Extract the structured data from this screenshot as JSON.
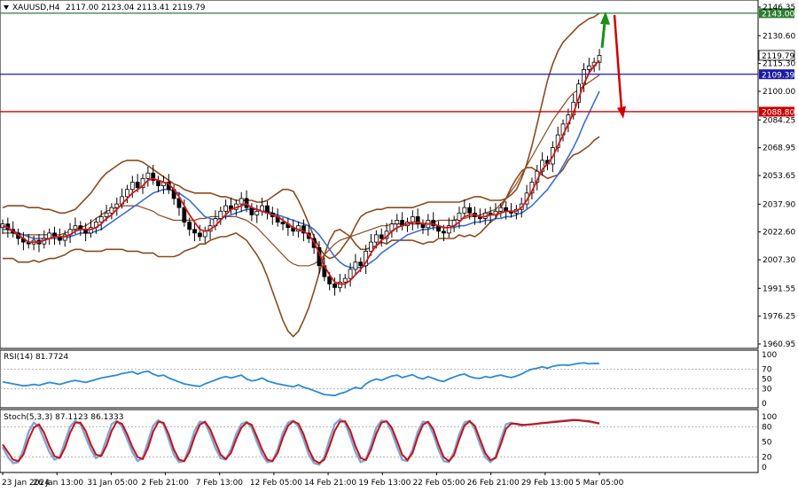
{
  "header": {
    "symbol": "XAUUSD,H4",
    "ohlc": "2117.00 2123.04 2113.41 2119.79"
  },
  "chart_data": {
    "type": "candlestick",
    "symbol": "XAUUSD",
    "timeframe": "H4",
    "current_price": 2119.79,
    "ylim": [
      1960.95,
      2146.35
    ],
    "y_ticks": [
      2146.35,
      2130.6,
      2115.3,
      2100.0,
      2084.25,
      2068.95,
      2053.65,
      2037.9,
      2022.6,
      2007.3,
      1991.55,
      1976.25,
      1960.95
    ],
    "x_ticks": [
      "23 Jan 2024",
      "26 Jan 13:00",
      "31 Jan 05:00",
      "2 Feb 21:00",
      "7 Feb 13:00",
      "12 Feb 05:00",
      "14 Feb 21:00",
      "19 Feb 13:00",
      "22 Feb 05:00",
      "26 Feb 21:00",
      "29 Feb 13:00",
      "5 Mar 05:00"
    ],
    "close_series": [
      2027,
      2024,
      2022,
      2019,
      2017,
      2016,
      2018,
      2016,
      2019,
      2022,
      2020,
      2018,
      2021,
      2024,
      2026,
      2024,
      2022,
      2025,
      2028,
      2031,
      2033,
      2036,
      2038,
      2042,
      2046,
      2050,
      2047,
      2052,
      2055,
      2051,
      2048,
      2050,
      2046,
      2041,
      2036,
      2028,
      2024,
      2022,
      2020,
      2023,
      2026,
      2030,
      2034,
      2037,
      2035,
      2038,
      2041,
      2036,
      2032,
      2034,
      2037,
      2033,
      2031,
      2028,
      2027,
      2025,
      2023,
      2026,
      2022,
      2019,
      2014,
      2004,
      1998,
      1994,
      1992,
      1995,
      1997,
      2002,
      2006,
      2004,
      2012,
      2017,
      2021,
      2019,
      2023,
      2027,
      2029,
      2026,
      2028,
      2031,
      2027,
      2025,
      2029,
      2026,
      2023,
      2022,
      2026,
      2029,
      2033,
      2036,
      2033,
      2031,
      2030,
      2033,
      2032,
      2034,
      2036,
      2034,
      2033,
      2035,
      2038,
      2044,
      2050,
      2056,
      2062,
      2060,
      2069,
      2076,
      2082,
      2087,
      2094,
      2104,
      2112,
      2114,
      2116,
      2119.79
    ],
    "bands": {
      "upper": [
        2036,
        2037,
        2037,
        2037,
        2037,
        2036,
        2036,
        2036,
        2035,
        2035,
        2034,
        2033,
        2033,
        2034,
        2035,
        2038,
        2041,
        2044,
        2048,
        2052,
        2055,
        2057,
        2059,
        2061,
        2062,
        2062,
        2062,
        2061,
        2059,
        2057,
        2055,
        2053,
        2051,
        2049,
        2048,
        2046,
        2045,
        2044,
        2044,
        2044,
        2044,
        2043,
        2042,
        2042,
        2041,
        2040,
        2040,
        2040,
        2040,
        2039,
        2039,
        2040,
        2042,
        2044,
        2046,
        2046,
        2045,
        2040,
        2034,
        2027,
        2020,
        2014,
        2010,
        2008,
        2009,
        2012,
        2016,
        2020,
        2026,
        2031,
        2033,
        2034,
        2035,
        2035,
        2036,
        2036,
        2036,
        2036,
        2036,
        2036,
        2037,
        2038,
        2039,
        2039,
        2039,
        2039,
        2039,
        2039,
        2039,
        2040,
        2041,
        2042,
        2042,
        2041,
        2040,
        2040,
        2040,
        2041,
        2043,
        2046,
        2052,
        2060,
        2070,
        2082,
        2094,
        2106,
        2115,
        2122,
        2127,
        2130,
        2133,
        2136,
        2138,
        2140,
        2141,
        2143
      ],
      "middle": [
        2022,
        2022,
        2022,
        2021,
        2021,
        2021,
        2021,
        2021,
        2021,
        2021,
        2021,
        2021,
        2022,
        2023,
        2024,
        2025,
        2026,
        2028,
        2030,
        2032,
        2034,
        2035,
        2036,
        2037,
        2037,
        2037,
        2037,
        2036,
        2035,
        2034,
        2032,
        2031,
        2030,
        2029,
        2029,
        2029,
        2029,
        2029,
        2030,
        2030,
        2031,
        2031,
        2031,
        2031,
        2031,
        2031,
        2030,
        2029,
        2027,
        2025,
        2022,
        2019,
        2016,
        2013,
        2010,
        2007,
        2005,
        2004,
        2004,
        2004,
        2005,
        2007,
        2010,
        2013,
        2016,
        2018,
        2019,
        2020,
        2021,
        2022,
        2023,
        2024,
        2025,
        2026,
        2026,
        2027,
        2027,
        2027,
        2027,
        2027,
        2027,
        2027,
        2028,
        2028,
        2029,
        2029,
        2029,
        2029,
        2030,
        2030,
        2031,
        2031,
        2032,
        2033,
        2034,
        2035,
        2038,
        2041,
        2045,
        2049,
        2054,
        2059,
        2064,
        2069,
        2074,
        2079,
        2084,
        2088,
        2092,
        2096,
        2099,
        2101,
        2103,
        2105,
        2107,
        2109
      ],
      "lower": [
        2008,
        2008,
        2008,
        2006,
        2006,
        2006,
        2007,
        2006,
        2007,
        2008,
        2008,
        2009,
        2010,
        2012,
        2013,
        2013,
        2012,
        2012,
        2012,
        2012,
        2013,
        2013,
        2013,
        2013,
        2012,
        2012,
        2012,
        2011,
        2011,
        2011,
        2009,
        2009,
        2009,
        2009,
        2010,
        2012,
        2013,
        2014,
        2016,
        2016,
        2018,
        2019,
        2020,
        2020,
        2021,
        2022,
        2020,
        2018,
        2014,
        2010,
        2005,
        1998,
        1990,
        1982,
        1974,
        1968,
        1965,
        1968,
        1974,
        1981,
        1990,
        2000,
        2010,
        2018,
        2023,
        2024,
        2022,
        2020,
        2016,
        2013,
        2013,
        2014,
        2015,
        2017,
        2016,
        2018,
        2018,
        2018,
        2018,
        2018,
        2017,
        2016,
        2017,
        2017,
        2019,
        2019,
        2019,
        2019,
        2021,
        2020,
        2021,
        2020,
        2022,
        2025,
        2028,
        2030,
        2036,
        2041,
        2047,
        2052,
        2056,
        2058,
        2058,
        2056,
        2054,
        2052,
        2053,
        2054,
        2057,
        2062,
        2065,
        2066,
        2068,
        2070,
        2073,
        2075
      ]
    },
    "ma_fast": [
      2026,
      2025,
      2023,
      2021,
      2019,
      2017,
      2017,
      2017,
      2018,
      2019,
      2020,
      2020,
      2020,
      2021,
      2023,
      2024,
      2024,
      2024,
      2025,
      2027,
      2030,
      2032,
      2035,
      2038,
      2041,
      2044,
      2046,
      2048,
      2051,
      2052,
      2051,
      2050,
      2049,
      2046,
      2042,
      2037,
      2032,
      2028,
      2024,
      2023,
      2024,
      2026,
      2029,
      2032,
      2035,
      2036,
      2037,
      2038,
      2036,
      2035,
      2034,
      2033,
      2032,
      2031,
      2029,
      2027,
      2025,
      2024,
      2023,
      2021,
      2017,
      2011,
      2004,
      1999,
      1995,
      1994,
      1994,
      1996,
      1999,
      2002,
      2006,
      2011,
      2015,
      2018,
      2020,
      2023,
      2025,
      2026,
      2027,
      2028,
      2028,
      2027,
      2027,
      2027,
      2026,
      2025,
      2025,
      2026,
      2028,
      2031,
      2032,
      2032,
      2031,
      2031,
      2032,
      2032,
      2033,
      2034,
      2034,
      2034,
      2036,
      2040,
      2045,
      2051,
      2057,
      2060,
      2064,
      2070,
      2076,
      2082,
      2088,
      2096,
      2104,
      2110,
      2114,
      2117
    ],
    "ma_slow": [
      2024,
      2024,
      2023,
      2022,
      2021,
      2020,
      2019,
      2019,
      2019,
      2019,
      2019,
      2019,
      2019,
      2020,
      2021,
      2022,
      2022,
      2022,
      2023,
      2024,
      2026,
      2028,
      2030,
      2032,
      2034,
      2036,
      2038,
      2040,
      2042,
      2044,
      2045,
      2046,
      2046,
      2045,
      2044,
      2042,
      2040,
      2037,
      2034,
      2031,
      2030,
      2029,
      2030,
      2031,
      2032,
      2033,
      2034,
      2035,
      2035,
      2035,
      2034,
      2034,
      2033,
      2032,
      2031,
      2030,
      2029,
      2028,
      2027,
      2026,
      2024,
      2021,
      2017,
      2013,
      2009,
      2006,
      2004,
      2003,
      2003,
      2003,
      2004,
      2006,
      2008,
      2011,
      2013,
      2015,
      2017,
      2019,
      2021,
      2022,
      2023,
      2024,
      2024,
      2025,
      2025,
      2025,
      2025,
      2025,
      2026,
      2026,
      2027,
      2028,
      2028,
      2029,
      2029,
      2030,
      2030,
      2031,
      2031,
      2032,
      2033,
      2035,
      2037,
      2040,
      2043,
      2046,
      2050,
      2054,
      2059,
      2064,
      2069,
      2075,
      2082,
      2088,
      2094,
      2100
    ],
    "levels": [
      {
        "value": "2143.00",
        "color": "#2e7d32"
      },
      {
        "value": "2109.39",
        "color": "#1a1aa6"
      },
      {
        "value": "2088.80",
        "color": "#cc0000"
      }
    ],
    "price_tag": "2119.79",
    "rsi": {
      "label": "RSI(14) 81.7724",
      "ylim": [
        0,
        100
      ],
      "ticks": [
        "100",
        "70",
        "50",
        "30",
        "0"
      ],
      "values": [
        44,
        42,
        40,
        38,
        36,
        37,
        39,
        37,
        40,
        43,
        41,
        39,
        42,
        45,
        47,
        45,
        43,
        46,
        49,
        52,
        54,
        56,
        58,
        61,
        63,
        65,
        60,
        64,
        66,
        60,
        56,
        58,
        52,
        48,
        44,
        40,
        38,
        36,
        35,
        40,
        44,
        48,
        52,
        55,
        52,
        55,
        58,
        50,
        46,
        48,
        52,
        46,
        43,
        40,
        38,
        36,
        34,
        38,
        33,
        30,
        26,
        22,
        18,
        17,
        16,
        20,
        23,
        28,
        33,
        30,
        40,
        46,
        50,
        47,
        52,
        56,
        58,
        53,
        56,
        59,
        53,
        50,
        55,
        51,
        47,
        45,
        50,
        54,
        58,
        60,
        55,
        52,
        51,
        55,
        53,
        56,
        58,
        55,
        53,
        56,
        60,
        66,
        70,
        72,
        75,
        72,
        76,
        78,
        79,
        78,
        80,
        82,
        83,
        81,
        82,
        81.77
      ]
    },
    "stoch": {
      "label": "Stoch(5,3,3) 87.1123 86.1333",
      "ylim": [
        0,
        100
      ],
      "ticks": [
        "100",
        "80",
        "50",
        "20",
        "0"
      ],
      "main": [
        40,
        20,
        8,
        10,
        35,
        70,
        88,
        80,
        55,
        30,
        15,
        20,
        50,
        80,
        92,
        85,
        60,
        35,
        18,
        25,
        55,
        85,
        92,
        80,
        55,
        30,
        12,
        18,
        50,
        82,
        93,
        85,
        55,
        25,
        10,
        12,
        40,
        72,
        90,
        88,
        65,
        38,
        18,
        15,
        35,
        65,
        85,
        90,
        78,
        50,
        25,
        10,
        12,
        35,
        68,
        88,
        92,
        80,
        55,
        25,
        8,
        5,
        20,
        55,
        85,
        95,
        88,
        60,
        30,
        10,
        15,
        45,
        78,
        92,
        90,
        70,
        40,
        15,
        12,
        35,
        70,
        90,
        88,
        65,
        35,
        12,
        10,
        30,
        65,
        88,
        92,
        75,
        45,
        20,
        10,
        20,
        55,
        85,
        88,
        85,
        82,
        84,
        85,
        86,
        88,
        88,
        90,
        91,
        92,
        93,
        94,
        93,
        91,
        90,
        88,
        87.11
      ],
      "signal": [
        45,
        30,
        15,
        12,
        25,
        55,
        78,
        85,
        68,
        42,
        22,
        18,
        38,
        68,
        88,
        88,
        72,
        45,
        25,
        22,
        42,
        72,
        90,
        86,
        65,
        40,
        20,
        16,
        38,
        70,
        90,
        88,
        65,
        35,
        15,
        12,
        30,
        60,
        84,
        90,
        75,
        50,
        25,
        16,
        28,
        55,
        78,
        88,
        84,
        60,
        35,
        15,
        12,
        28,
        58,
        82,
        91,
        86,
        65,
        35,
        14,
        8,
        15,
        42,
        72,
        90,
        91,
        72,
        42,
        18,
        14,
        35,
        66,
        88,
        91,
        78,
        52,
        25,
        14,
        28,
        60,
        84,
        90,
        75,
        45,
        20,
        12,
        24,
        55,
        82,
        91,
        82,
        55,
        28,
        14,
        18,
        45,
        76,
        86,
        86,
        84,
        84,
        85,
        86,
        87,
        88,
        89,
        90,
        91,
        92,
        93,
        93,
        92,
        91,
        89,
        86.13
      ]
    },
    "arrows": [
      {
        "direction": "up",
        "color": "#1a8f1a"
      },
      {
        "direction": "down",
        "color": "#d10000"
      }
    ]
  }
}
